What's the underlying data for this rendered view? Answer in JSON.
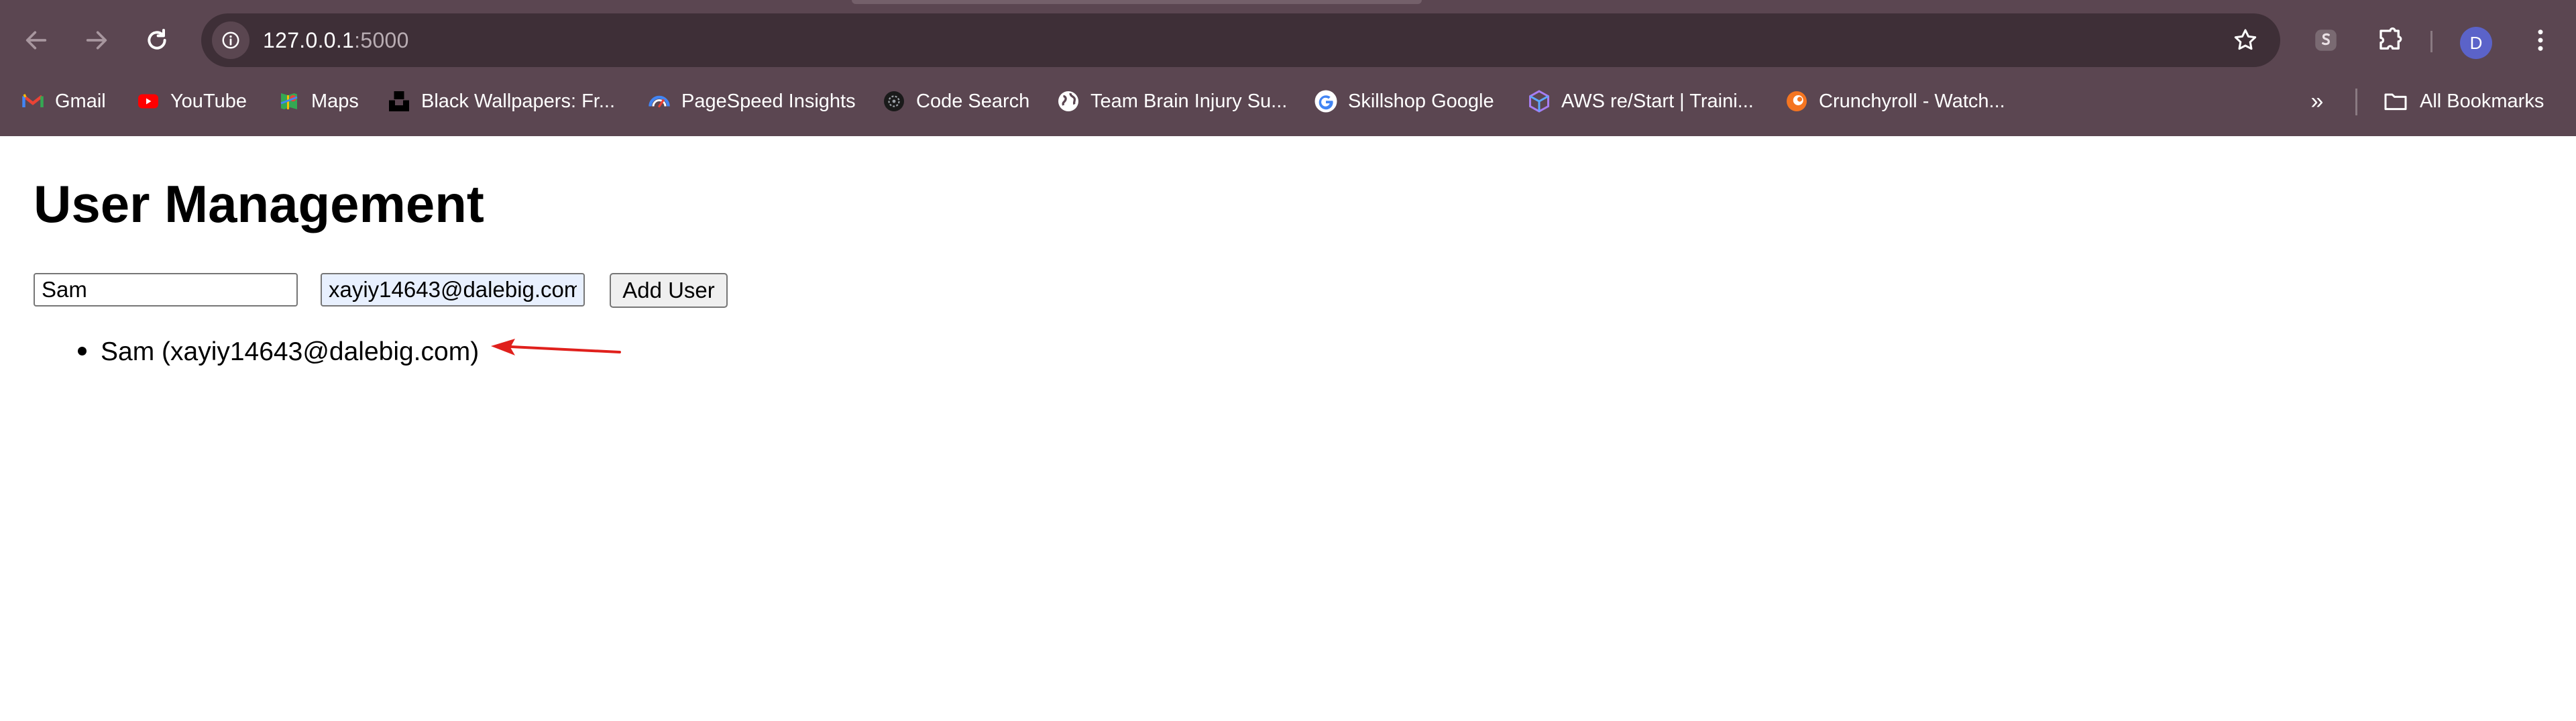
{
  "browser": {
    "url_host": "127.0.0.1",
    "url_port": ":5000",
    "profile_initial": "D",
    "bookmarks": [
      {
        "label": "Gmail",
        "icon": "gmail-icon"
      },
      {
        "label": "YouTube",
        "icon": "youtube-icon"
      },
      {
        "label": "Maps",
        "icon": "maps-icon"
      },
      {
        "label": "Black Wallpapers: Fr...",
        "icon": "unsplash-icon"
      },
      {
        "label": "PageSpeed Insights",
        "icon": "pagespeed-icon"
      },
      {
        "label": "Code Search",
        "icon": "code-search-icon"
      },
      {
        "label": "Team Brain Injury Su...",
        "icon": "globe-icon"
      },
      {
        "label": "Skillshop Google",
        "icon": "google-icon"
      },
      {
        "label": "AWS re/Start | Traini...",
        "icon": "aws-icon"
      },
      {
        "label": "Crunchyroll - Watch...",
        "icon": "crunchyroll-icon"
      }
    ],
    "all_bookmarks_label": "All Bookmarks",
    "overflow_label": "»"
  },
  "page": {
    "title": "User Management",
    "name_input_value": "Sam",
    "email_input_value": "xayiy14643@dalebig.com",
    "add_button_label": "Add User",
    "users": [
      {
        "display": "Sam (xayiy14643@dalebig.com)"
      }
    ]
  },
  "colors": {
    "chrome_bg": "#5b4651",
    "omnibox_bg": "#3e2f37",
    "annotation_arrow": "#e0201c"
  }
}
